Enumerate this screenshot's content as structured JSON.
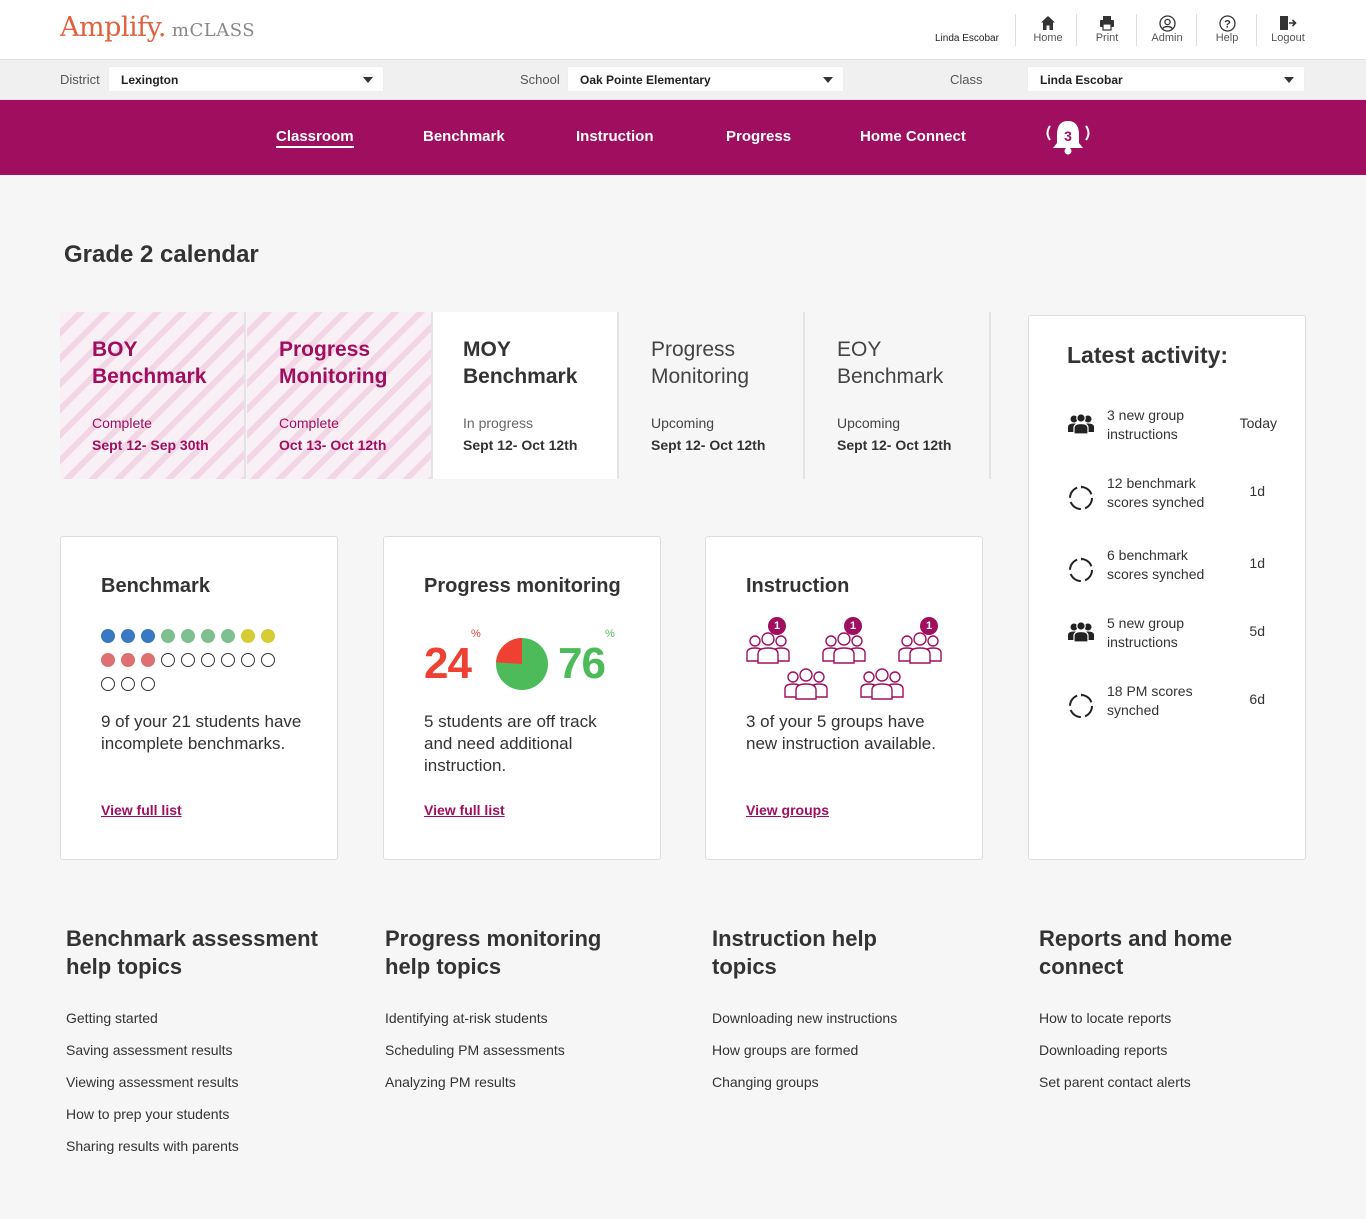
{
  "header": {
    "logo_main": "Amplify.",
    "logo_sub": "mCLASS",
    "user": "Linda Escobar",
    "tools": [
      {
        "label": "Home",
        "icon": "home-icon"
      },
      {
        "label": "Print",
        "icon": "print-icon"
      },
      {
        "label": "Admin",
        "icon": "admin-icon"
      },
      {
        "label": "Help",
        "icon": "help-icon"
      },
      {
        "label": "Logout",
        "icon": "logout-icon"
      }
    ]
  },
  "filters": {
    "district_label": "District",
    "district_value": "Lexington",
    "school_label": "School",
    "school_value": "Oak Pointe Elementary",
    "class_label": "Class",
    "class_value": "Linda Escobar"
  },
  "nav": {
    "items": [
      "Classroom",
      "Benchmark",
      "Instruction",
      "Progress",
      "Home Connect"
    ],
    "active": "Classroom",
    "notification_count": "3"
  },
  "page_title": "Grade 2 calendar",
  "calendar": [
    {
      "title_1": "BOY",
      "title_2": "Benchmark",
      "status": "Complete",
      "dates": "Sept 12- Sep 30th"
    },
    {
      "title_1": "Progress",
      "title_2": "Monitoring",
      "status": "Complete",
      "dates": "Oct 13- Oct 12th"
    },
    {
      "title_1": "MOY",
      "title_2": "Benchmark",
      "status": "In progress",
      "dates": "Sept 12- Oct 12th"
    },
    {
      "title_1": "Progress",
      "title_2": "Monitoring",
      "status": "Upcoming",
      "dates": "Sept 12- Oct 12th"
    },
    {
      "title_1": "EOY",
      "title_2": "Benchmark",
      "status": "Upcoming",
      "dates": "Sept 12- Oct 12th"
    }
  ],
  "cards": {
    "benchmark": {
      "title": "Benchmark",
      "desc": "9 of your 21 students have incomplete benchmarks.",
      "link": "View full list",
      "dots": [
        "blue",
        "blue",
        "blue",
        "green",
        "green",
        "green",
        "green",
        "yellow",
        "yellow",
        "red",
        "red",
        "red",
        "empty",
        "empty",
        "empty",
        "empty",
        "empty",
        "empty",
        "empty",
        "empty",
        "empty"
      ]
    },
    "progress": {
      "title": "Progress monitoring",
      "off_track_pct": "24",
      "on_track_pct": "76",
      "pct_symbol": "%",
      "desc": "5 students are off track and need additional instruction.",
      "link": "View full list"
    },
    "instruction": {
      "title": "Instruction",
      "badge": "1",
      "desc": "3 of your 5 groups have new instruction available.",
      "link": "View groups"
    }
  },
  "colors": {
    "brand": "#a00e5f",
    "dot_blue": "#3a78c3",
    "dot_green": "#7ec08f",
    "dot_yellow": "#d8cc36",
    "dot_red": "#de6f73",
    "pm_red": "#ee4033",
    "pm_green": "#4dbb5a"
  },
  "activity": {
    "title": "Latest activity:",
    "items": [
      {
        "icon": "group-icon",
        "text": "3 new group instructions",
        "when": "Today"
      },
      {
        "icon": "sync-icon",
        "text": "12 benchmark scores synched",
        "when": "1d"
      },
      {
        "icon": "sync-icon",
        "text": "6 benchmark scores synched",
        "when": "1d"
      },
      {
        "icon": "group-icon",
        "text": "5 new group instructions",
        "when": "5d"
      },
      {
        "icon": "sync-icon",
        "text": "18 PM scores synched",
        "when": "6d"
      }
    ]
  },
  "help": [
    {
      "title": "Benchmark assessment help topics",
      "links": [
        "Getting started",
        "Saving assessment results",
        "Viewing assessment results",
        "How to prep your students",
        "Sharing results with parents"
      ]
    },
    {
      "title": "Progress monitoring help topics",
      "links": [
        "Identifying at-risk students",
        "Scheduling PM assessments",
        "Analyzing PM results"
      ]
    },
    {
      "title": "Instruction help topics",
      "links": [
        "Downloading new instructions",
        "How groups are formed",
        "Changing groups"
      ]
    },
    {
      "title": "Reports and home connect",
      "links": [
        "How to locate reports",
        "Downloading reports",
        "Set parent contact alerts"
      ]
    }
  ]
}
